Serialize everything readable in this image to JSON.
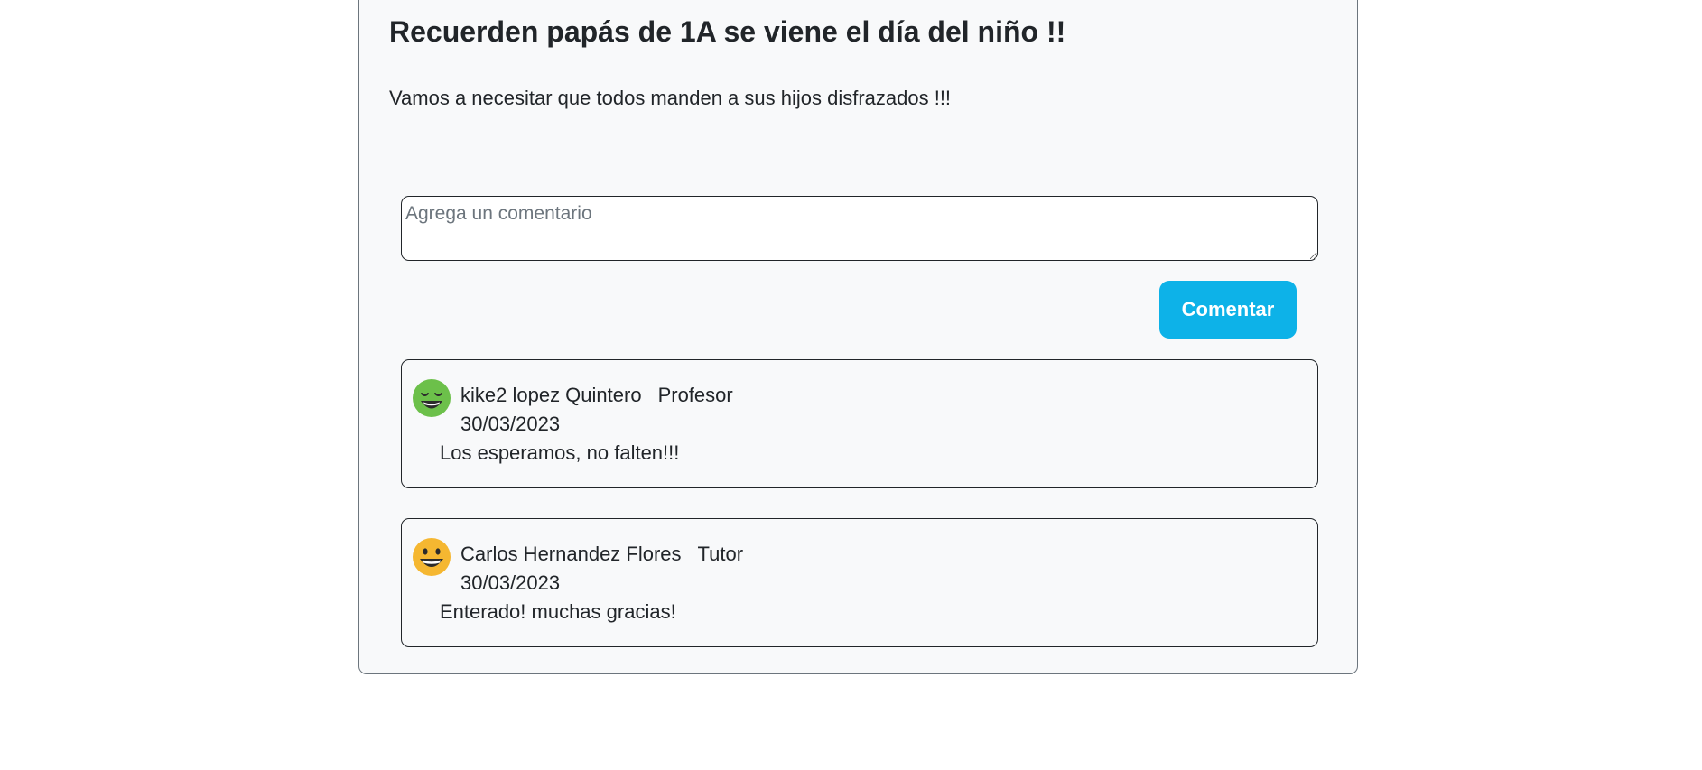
{
  "post": {
    "title": "Recuerden papás de 1A se viene el día del niño !!",
    "body": "Vamos a necesitar que todos manden a sus hijos disfrazados !!!"
  },
  "comment_form": {
    "placeholder": "Agrega un comentario",
    "value": "",
    "submit_label": "Comentar"
  },
  "comments": [
    {
      "author": "kike2 lopez Quintero",
      "role": "Profesor",
      "date": "30/03/2023",
      "text": "Los esperamos, no falten!!!",
      "avatar_icon": "relieved-face-icon",
      "avatar_color": "#6cc04a"
    },
    {
      "author": "Carlos Hernandez Flores",
      "role": "Tutor",
      "date": "30/03/2023",
      "text": "Enterado! muchas gracias!",
      "avatar_icon": "grinning-face-icon",
      "avatar_color": "#f5b731"
    }
  ],
  "colors": {
    "accent": "#0db2e8",
    "card_background": "#f8f9fa",
    "text": "#212529"
  }
}
